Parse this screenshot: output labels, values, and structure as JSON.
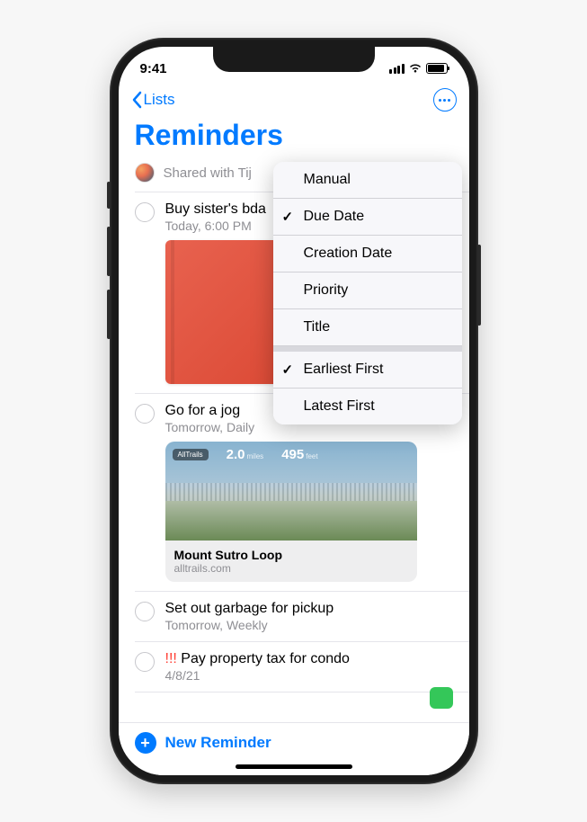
{
  "status": {
    "time": "9:41"
  },
  "nav": {
    "back_label": "Lists"
  },
  "header": {
    "title": "Reminders",
    "shared_with": "Shared with Tij"
  },
  "reminders": [
    {
      "title": "Buy sister's bda",
      "subtitle": "Today, 6:00 PM",
      "has_image": true
    },
    {
      "title": "Go for a jog",
      "subtitle": "Tomorrow, Daily",
      "assigned": true,
      "link": {
        "badge": "AllTrails",
        "stat1_num": "2.0",
        "stat1_unit": "miles",
        "stat2_num": "495",
        "stat2_unit": "feet",
        "title": "Mount Sutro Loop",
        "domain": "alltrails.com"
      }
    },
    {
      "title": "Set out garbage for pickup",
      "subtitle": "Tomorrow, Weekly"
    },
    {
      "priority_prefix": "!!! ",
      "title": "Pay property tax for condo",
      "subtitle": "4/8/21"
    }
  ],
  "sort_menu": {
    "items": [
      {
        "label": "Manual",
        "checked": false
      },
      {
        "label": "Due Date",
        "checked": true
      },
      {
        "label": "Creation Date",
        "checked": false
      },
      {
        "label": "Priority",
        "checked": false
      },
      {
        "label": "Title",
        "checked": false
      }
    ],
    "order": [
      {
        "label": "Earliest First",
        "checked": true
      },
      {
        "label": "Latest First",
        "checked": false
      }
    ]
  },
  "bottom": {
    "new_label": "New Reminder"
  }
}
